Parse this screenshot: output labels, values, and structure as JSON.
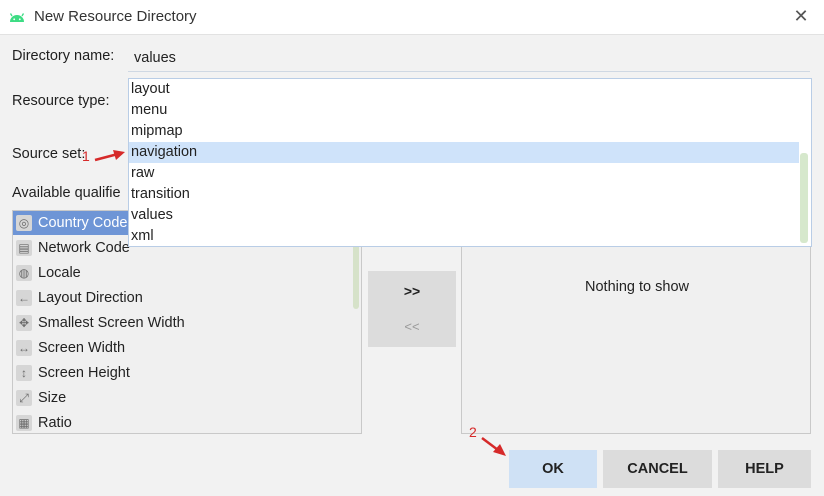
{
  "window": {
    "title": "New Resource Directory",
    "app_icon": "android-icon",
    "close_icon": "close-icon",
    "close_glyph": "✕"
  },
  "form": {
    "directory_name_label": "Directory name:",
    "directory_name_value": "values",
    "resource_type_label": "Resource type:",
    "source_set_label": "Source set:",
    "available_qualifiers_label": "Available qualifie"
  },
  "resource_type_options": [
    {
      "label": "layout",
      "selected": false
    },
    {
      "label": "menu",
      "selected": false
    },
    {
      "label": "mipmap",
      "selected": false
    },
    {
      "label": "navigation",
      "selected": true
    },
    {
      "label": "raw",
      "selected": false
    },
    {
      "label": "transition",
      "selected": false
    },
    {
      "label": "values",
      "selected": false
    },
    {
      "label": "xml",
      "selected": false
    }
  ],
  "qualifiers": [
    {
      "label": "Country Code",
      "icon": "country-code-icon",
      "glyph": "◎",
      "selected": true
    },
    {
      "label": "Network Code",
      "icon": "network-code-icon",
      "glyph": "▤",
      "selected": false
    },
    {
      "label": "Locale",
      "icon": "globe-icon",
      "glyph": "◍",
      "selected": false
    },
    {
      "label": "Layout Direction",
      "icon": "arrow-left-icon",
      "glyph": "←",
      "selected": false
    },
    {
      "label": "Smallest Screen Width",
      "icon": "move-icon",
      "glyph": "✥",
      "selected": false
    },
    {
      "label": "Screen Width",
      "icon": "horizontal-resize-icon",
      "glyph": "↔",
      "selected": false
    },
    {
      "label": "Screen Height",
      "icon": "vertical-resize-icon",
      "glyph": "↕",
      "selected": false
    },
    {
      "label": "Size",
      "icon": "diagonal-resize-icon",
      "glyph": "⤢",
      "selected": false
    },
    {
      "label": "Ratio",
      "icon": "ratio-icon",
      "glyph": "▦",
      "selected": false
    }
  ],
  "chosen_qualifiers": {
    "empty_text": "Nothing to show"
  },
  "transfer": {
    "add_label": ">>",
    "remove_label": "<<"
  },
  "buttons": {
    "ok": "OK",
    "cancel": "CANCEL",
    "help": "HELP"
  },
  "annotations": {
    "marker_1": "1",
    "marker_2": "2",
    "color": "#d62a2a"
  },
  "colors": {
    "selection_list": "#6e95d6",
    "selection_dropdown": "#cfe3fa",
    "ok_button": "#cfe1f5"
  }
}
